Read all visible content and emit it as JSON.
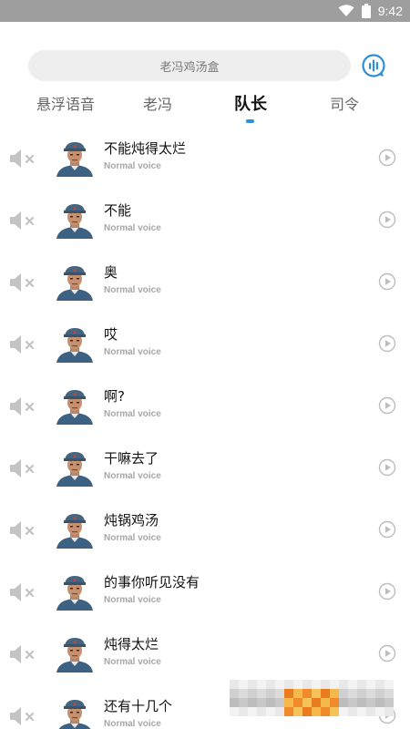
{
  "status_bar": {
    "time": "9:42"
  },
  "search": {
    "label": "老冯鸡汤盒"
  },
  "tabs": [
    {
      "label": "悬浮语音",
      "active": false
    },
    {
      "label": "老冯",
      "active": false
    },
    {
      "label": "队长",
      "active": true
    },
    {
      "label": "司令",
      "active": false
    }
  ],
  "list": [
    {
      "title": "不能炖得太烂",
      "subtitle": "Normal voice"
    },
    {
      "title": "不能",
      "subtitle": "Normal voice"
    },
    {
      "title": "奥",
      "subtitle": "Normal voice"
    },
    {
      "title": "哎",
      "subtitle": "Normal voice"
    },
    {
      "title": "啊?",
      "subtitle": "Normal voice"
    },
    {
      "title": "干嘛去了",
      "subtitle": "Normal voice"
    },
    {
      "title": "炖锅鸡汤",
      "subtitle": "Normal voice"
    },
    {
      "title": "的事你听见没有",
      "subtitle": "Normal voice"
    },
    {
      "title": "炖得太烂",
      "subtitle": "Normal voice"
    },
    {
      "title": "还有十几个",
      "subtitle": "Normal voice"
    }
  ],
  "colors": {
    "accent": "#2d8fd8",
    "status_bar": "#9e9e9e",
    "muted_icon": "#bdbdbd"
  }
}
